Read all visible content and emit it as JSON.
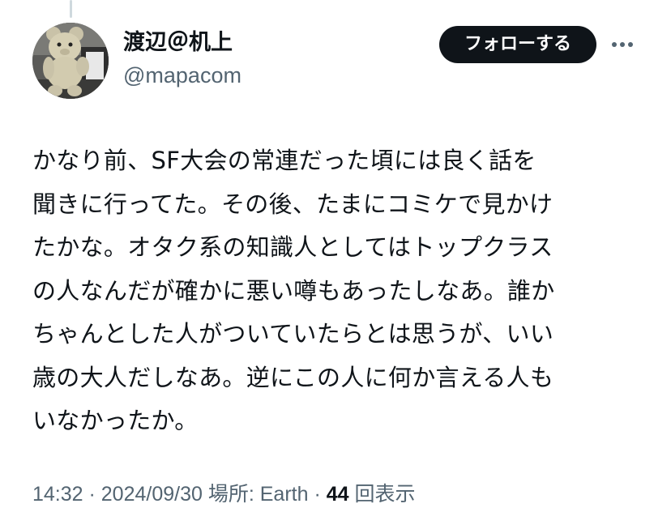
{
  "user": {
    "display_name": "渡辺＠机上",
    "handle": "@mapacom",
    "avatar_icon": "teddy-bear-avatar"
  },
  "actions": {
    "follow_label": "フォローする",
    "more_icon": "ellipsis-icon"
  },
  "tweet": {
    "lines": [
      "かなり前、SF大会の常連だった頃には良く話を",
      "聞きに行ってた。その後、たまにコミケで見かけ",
      "たかな。オタク系の知識人としてはトップクラス",
      "の人なんだが確かに悪い噂もあったしなあ。誰か",
      "ちゃんとした人がついていたらとは思うが、いい",
      "歳の大人だしなあ。逆にこの人に何か言える人も",
      "いなかったか。"
    ]
  },
  "meta": {
    "time": "14:32",
    "sep1": " · ",
    "date": "2024/09/30",
    "location_label": " 場所: ",
    "location": "Earth",
    "sep2": " · ",
    "views_count": "44",
    "views_label": " 回表示"
  },
  "colors": {
    "text": "#0f1419",
    "secondary": "#536471",
    "button_bg": "#0f1419",
    "button_text": "#ffffff",
    "thread_line": "#cfd9de"
  }
}
